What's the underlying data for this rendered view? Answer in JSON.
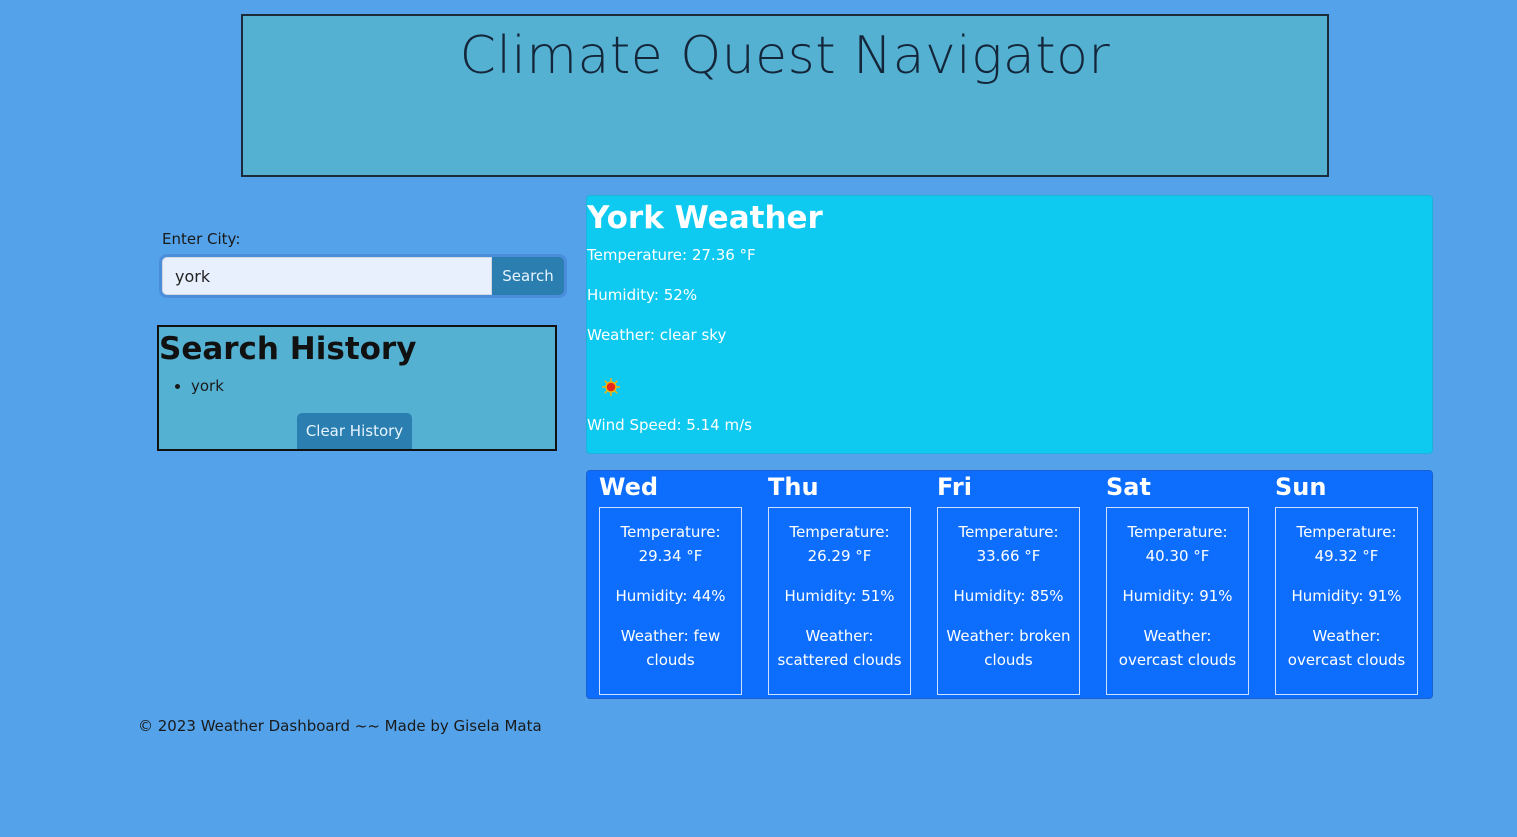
{
  "header": {
    "title": "Climate Quest Navigator"
  },
  "search": {
    "label": "Enter City:",
    "value": "york",
    "button": "Search"
  },
  "history": {
    "title": "Search History",
    "items": [
      "york"
    ],
    "clear_button": "Clear History"
  },
  "current": {
    "title": "York Weather",
    "temperature": "Temperature: 27.36 °F",
    "humidity": "Humidity: 52%",
    "weather": "Weather: clear sky",
    "icon": "sun-icon",
    "wind": "Wind Speed: 5.14 m/s"
  },
  "forecast": [
    {
      "day": "Wed",
      "temp_label": "Temperature:",
      "temp": "29.34 °F",
      "humidity": "Humidity: 44%",
      "weather": "Weather: few clouds"
    },
    {
      "day": "Thu",
      "temp_label": "Temperature:",
      "temp": "26.29 °F",
      "humidity": "Humidity: 51%",
      "weather": "Weather: scattered clouds"
    },
    {
      "day": "Fri",
      "temp_label": "Temperature:",
      "temp": "33.66 °F",
      "humidity": "Humidity: 85%",
      "weather": "Weather: broken clouds"
    },
    {
      "day": "Sat",
      "temp_label": "Temperature:",
      "temp": "40.30 °F",
      "humidity": "Humidity: 91%",
      "weather": "Weather: overcast clouds"
    },
    {
      "day": "Sun",
      "temp_label": "Temperature:",
      "temp": "49.32 °F",
      "humidity": "Humidity: 91%",
      "weather": "Weather: overcast clouds"
    }
  ],
  "footer": {
    "text": "© 2023 Weather Dashboard ~~ Made by Gisela Mata"
  },
  "colors": {
    "page_bg": "#53a2ea",
    "header_bg": "#55b1d2",
    "current_bg": "#0ecaf0",
    "forecast_bg": "#0d6efd",
    "button_bg": "#2a7fb0"
  }
}
